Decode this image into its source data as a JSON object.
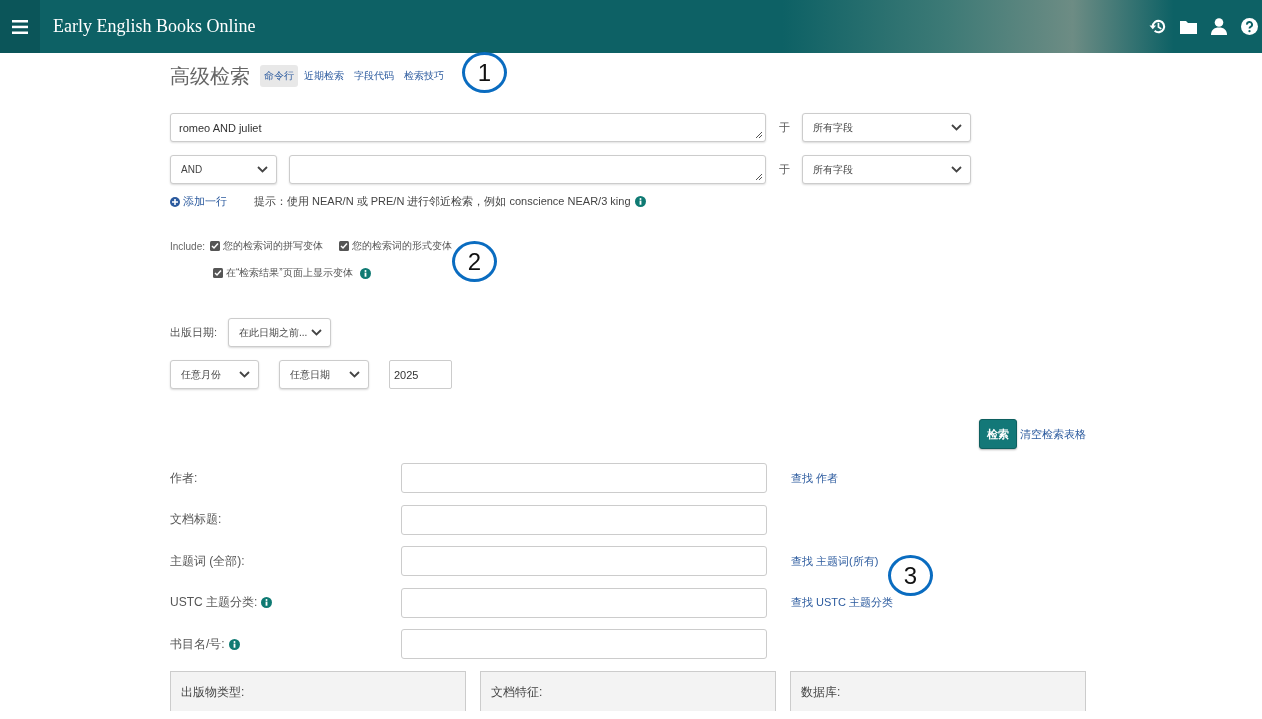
{
  "header": {
    "title": "Early English Books Online"
  },
  "page": {
    "title": "高级检索"
  },
  "tabs": [
    {
      "label": "命令行",
      "selected": true
    },
    {
      "label": "近期检索",
      "selected": false
    },
    {
      "label": "字段代码",
      "selected": false
    },
    {
      "label": "检索技巧",
      "selected": false
    }
  ],
  "query_rows": [
    {
      "kind": "first",
      "value": "romeo AND juliet",
      "in_label": "于",
      "field": "所有字段"
    },
    {
      "kind": "operator",
      "operator": "AND",
      "in_label": "于",
      "field": "所有字段"
    }
  ],
  "add_row": "添加一行",
  "hint": "提示：使用 NEAR/N 或 PRE/N 进行邻近检索，例如 conscience NEAR/3 king",
  "include": {
    "label": "Include:",
    "options": [
      {
        "label": "您的检索词的拼写变体",
        "checked": true,
        "info": false
      },
      {
        "label": "您的检索词的形式变体",
        "checked": true,
        "info": false
      },
      {
        "label": "在“检索结果”页面上显示变体",
        "checked": true,
        "info": true
      }
    ]
  },
  "date": {
    "label": "出版日期:",
    "mode": "在此日期之前...",
    "month": "任意月份",
    "day": "任意日期",
    "year": "2025"
  },
  "actions": {
    "search": "检索",
    "clear": "清空检索表格"
  },
  "fields": [
    {
      "label": "作者:",
      "info": false,
      "lookup": "查找 作者"
    },
    {
      "label": "文档标题:",
      "info": false
    },
    {
      "label": "主题词 (全部):",
      "info": false,
      "lookup": "查找 主题词(所有)"
    },
    {
      "label": "USTC 主题分类:",
      "info": true,
      "lookup": "查找 USTC 主题分类"
    },
    {
      "label": "书目名/号:",
      "info": true
    }
  ],
  "panels": [
    "出版物类型:",
    "文档特征:",
    "数据库:"
  ],
  "callouts": [
    "1",
    "2",
    "3"
  ]
}
